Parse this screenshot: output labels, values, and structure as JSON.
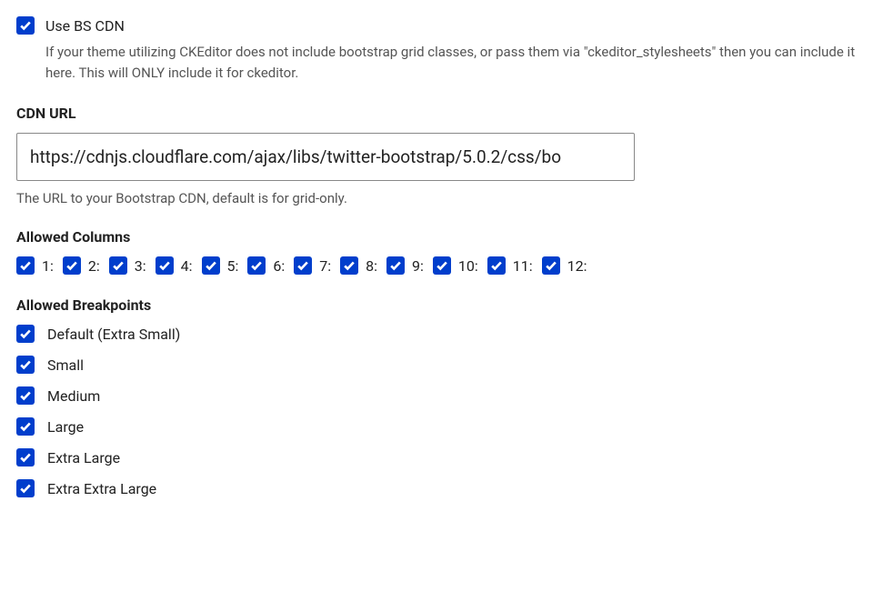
{
  "use_cdn": {
    "label": "Use BS CDN",
    "checked": true,
    "help": "If your theme utilizing CKEditor does not include bootstrap grid classes, or pass them via \"ckeditor_stylesheets\" then you can include it here. This will ONLY include it for ckeditor."
  },
  "cdn_url": {
    "label": "CDN URL",
    "value": "https://cdnjs.cloudflare.com/ajax/libs/twitter-bootstrap/5.0.2/css/bo",
    "help": "The URL to your Bootstrap CDN, default is for grid-only."
  },
  "allowed_columns": {
    "label": "Allowed Columns",
    "items": [
      {
        "label": "1:",
        "checked": true
      },
      {
        "label": "2:",
        "checked": true
      },
      {
        "label": "3:",
        "checked": true
      },
      {
        "label": "4:",
        "checked": true
      },
      {
        "label": "5:",
        "checked": true
      },
      {
        "label": "6:",
        "checked": true
      },
      {
        "label": "7:",
        "checked": true
      },
      {
        "label": "8:",
        "checked": true
      },
      {
        "label": "9:",
        "checked": true
      },
      {
        "label": "10:",
        "checked": true
      },
      {
        "label": "11:",
        "checked": true
      },
      {
        "label": "12:",
        "checked": true
      }
    ]
  },
  "allowed_breakpoints": {
    "label": "Allowed Breakpoints",
    "items": [
      {
        "label": "Default (Extra Small)",
        "checked": true
      },
      {
        "label": "Small",
        "checked": true
      },
      {
        "label": "Medium",
        "checked": true
      },
      {
        "label": "Large",
        "checked": true
      },
      {
        "label": "Extra Large",
        "checked": true
      },
      {
        "label": "Extra Extra Large",
        "checked": true
      }
    ]
  }
}
